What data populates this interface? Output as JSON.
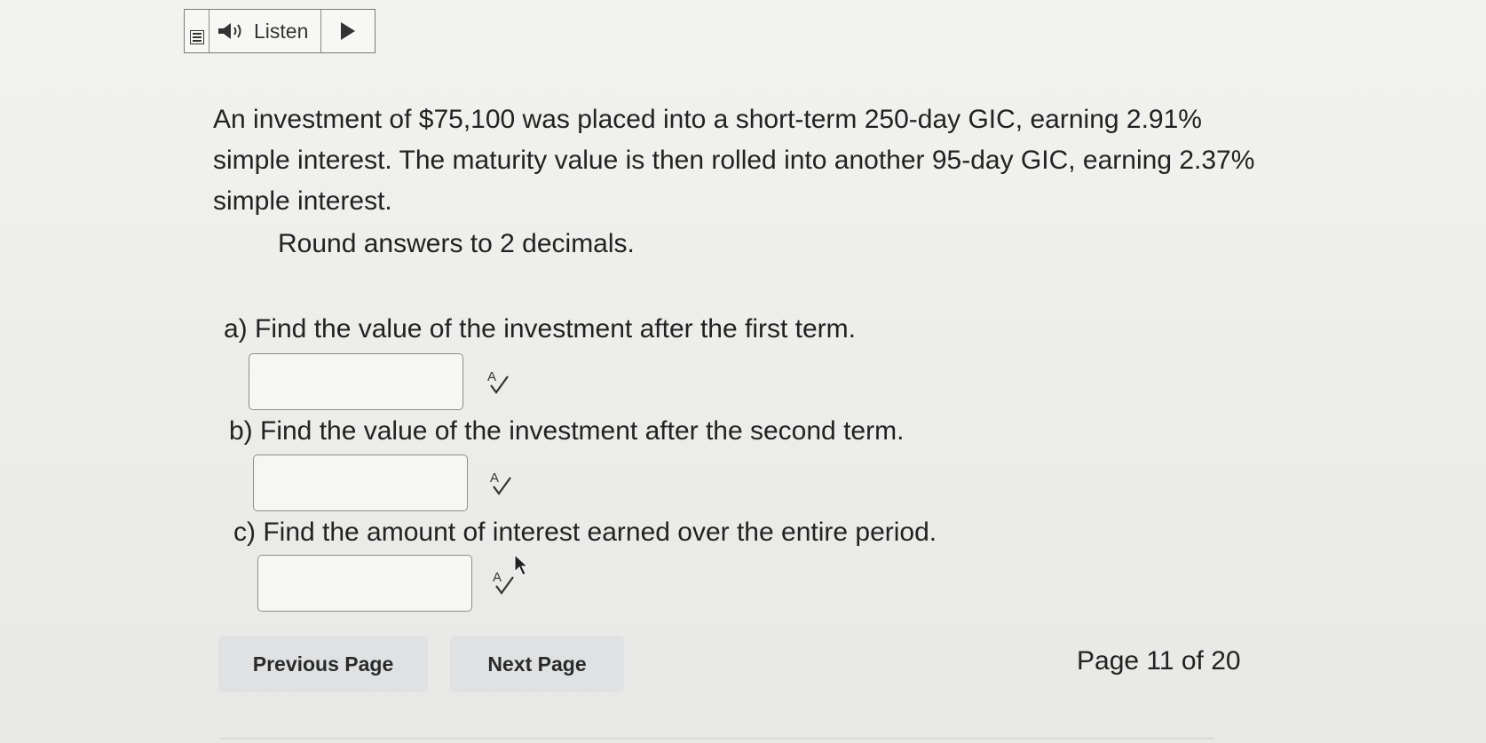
{
  "toolbar": {
    "listen_label": "Listen",
    "menu_icon": "menu-icon",
    "speaker_icon": "speaker-icon",
    "play_icon": "play-icon"
  },
  "question": {
    "text": "An investment of $75,100 was placed into a short-term 250-day GIC, earning 2.91% simple interest. The maturity value is then rolled into another 95-day GIC, earning 2.37% simple interest.",
    "rounding_note": "Round answers to 2 decimals."
  },
  "parts": [
    {
      "label": "a) Find the value of the investment after the first term.",
      "value": "",
      "check_icon": "spellcheck-icon"
    },
    {
      "label": "b) Find the value of the investment after the second term.",
      "value": "",
      "check_icon": "spellcheck-icon"
    },
    {
      "label": "c) Find the amount of interest earned over the entire period.",
      "value": "",
      "check_icon": "spellcheck-icon"
    }
  ],
  "navigation": {
    "previous_label": "Previous Page",
    "next_label": "Next Page",
    "page_indicator": "Page 11 of 20"
  }
}
